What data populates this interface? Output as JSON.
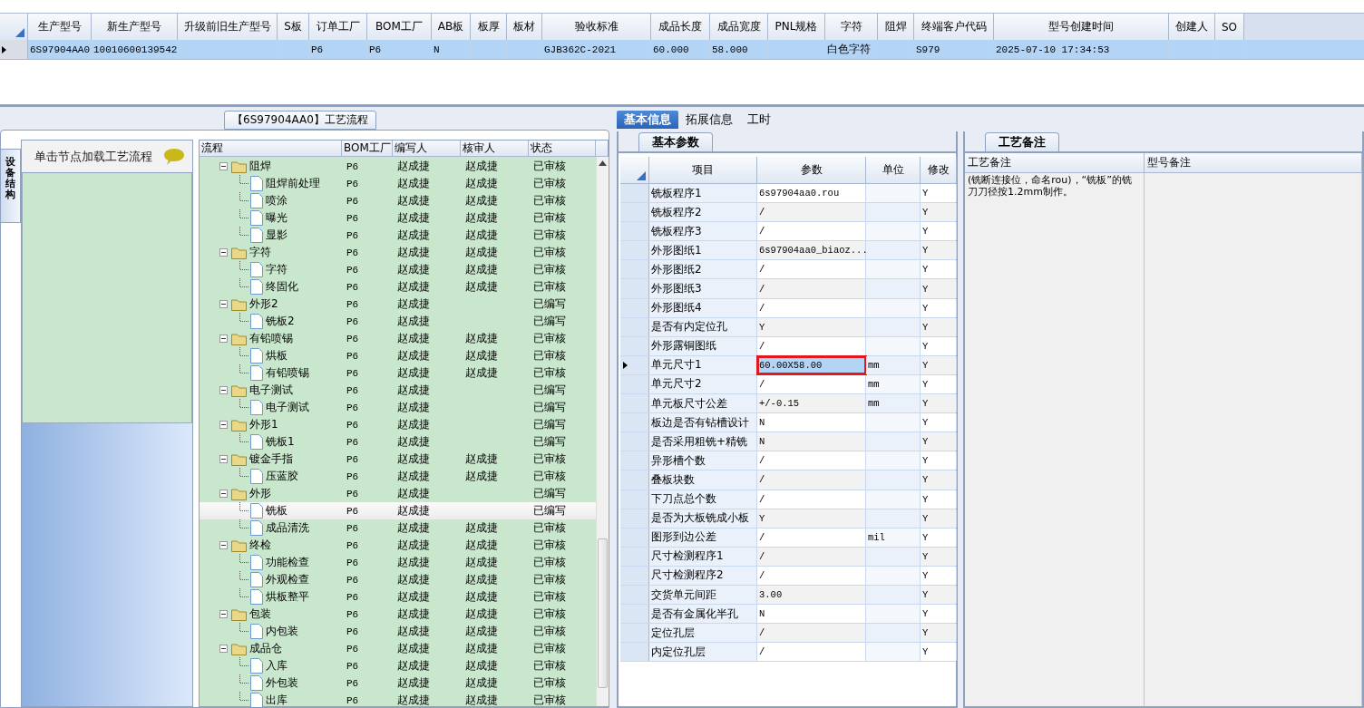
{
  "record_grid": {
    "columns": [
      "生产型号",
      "新生产型号",
      "升级前旧生产型号",
      "S板",
      "订单工厂",
      "BOM工厂",
      "AB板",
      "板厚",
      "板材",
      "验收标准",
      "成品长度",
      "成品宽度",
      "PNL规格",
      "字符",
      "阻焊",
      "终端客户代码",
      "型号创建时间",
      "创建人",
      "SO"
    ],
    "rows": [
      {
        "selected": true,
        "cells": [
          "6S97904AA0",
          "10010600139542",
          null,
          null,
          "P6",
          "P6",
          "N",
          null,
          null,
          "GJB362C-2021",
          "60.000",
          "58.000",
          null,
          "白色字符",
          null,
          "S979",
          "2025-07-10 17:34:53",
          null,
          null
        ]
      }
    ]
  },
  "process_panel": {
    "title": "【6S97904AA0】工艺流程",
    "side_tab": "设备结构",
    "hint": "单击节点加载工艺流程",
    "tree": {
      "columns": [
        "流程",
        "BOM工厂",
        "编写人",
        "核审人",
        "状态"
      ],
      "nodes": [
        {
          "name": "阻焊",
          "bom": "P6",
          "writer": "赵成捷",
          "reviewer": "赵成捷",
          "status": "已审核",
          "expanded": true,
          "selected": false,
          "children": [
            {
              "name": "阻焊前处理",
              "bom": "P6",
              "writer": "赵成捷",
              "reviewer": "赵成捷",
              "status": "已审核",
              "selected": false
            },
            {
              "name": "喷涂",
              "bom": "P6",
              "writer": "赵成捷",
              "reviewer": "赵成捷",
              "status": "已审核",
              "selected": false
            },
            {
              "name": "曝光",
              "bom": "P6",
              "writer": "赵成捷",
              "reviewer": "赵成捷",
              "status": "已审核",
              "selected": false
            },
            {
              "name": "显影",
              "bom": "P6",
              "writer": "赵成捷",
              "reviewer": "赵成捷",
              "status": "已审核",
              "selected": false
            }
          ]
        },
        {
          "name": "字符",
          "bom": "P6",
          "writer": "赵成捷",
          "reviewer": "赵成捷",
          "status": "已审核",
          "expanded": true,
          "selected": false,
          "children": [
            {
              "name": "字符",
              "bom": "P6",
              "writer": "赵成捷",
              "reviewer": "赵成捷",
              "status": "已审核",
              "selected": false
            },
            {
              "name": "终固化",
              "bom": "P6",
              "writer": "赵成捷",
              "reviewer": "赵成捷",
              "status": "已审核",
              "selected": false
            }
          ]
        },
        {
          "name": "外形2",
          "bom": "P6",
          "writer": "赵成捷",
          "status": "已编写",
          "expanded": true,
          "selected": false,
          "children": [
            {
              "name": "铣板2",
              "bom": "P6",
              "writer": "赵成捷",
              "status": "已编写",
              "selected": false
            }
          ]
        },
        {
          "name": "有铅喷锡",
          "bom": "P6",
          "writer": "赵成捷",
          "reviewer": "赵成捷",
          "status": "已审核",
          "expanded": true,
          "selected": false,
          "children": [
            {
              "name": "烘板",
              "bom": "P6",
              "writer": "赵成捷",
              "reviewer": "赵成捷",
              "status": "已审核",
              "selected": false
            },
            {
              "name": "有铅喷锡",
              "bom": "P6",
              "writer": "赵成捷",
              "reviewer": "赵成捷",
              "status": "已审核",
              "selected": false
            }
          ]
        },
        {
          "name": "电子测试",
          "bom": "P6",
          "writer": "赵成捷",
          "status": "已编写",
          "expanded": true,
          "selected": false,
          "children": [
            {
              "name": "电子测试",
              "bom": "P6",
              "writer": "赵成捷",
              "status": "已编写",
              "selected": false
            }
          ]
        },
        {
          "name": "外形1",
          "bom": "P6",
          "writer": "赵成捷",
          "status": "已编写",
          "expanded": true,
          "selected": false,
          "children": [
            {
              "name": "铣板1",
              "bom": "P6",
              "writer": "赵成捷",
              "status": "已编写",
              "selected": false
            }
          ]
        },
        {
          "name": "镀金手指",
          "bom": "P6",
          "writer": "赵成捷",
          "reviewer": "赵成捷",
          "status": "已审核",
          "expanded": true,
          "selected": false,
          "children": [
            {
              "name": "压蓝胶",
              "bom": "P6",
              "writer": "赵成捷",
              "reviewer": "赵成捷",
              "status": "已审核",
              "selected": false
            }
          ]
        },
        {
          "name": "外形",
          "bom": "P6",
          "writer": "赵成捷",
          "status": "已编写",
          "expanded": true,
          "selected": false,
          "children": [
            {
              "name": "铣板",
              "bom": "P6",
              "writer": "赵成捷",
              "status": "已编写",
              "selected": true
            },
            {
              "name": "成品清洗",
              "bom": "P6",
              "writer": "赵成捷",
              "reviewer": "赵成捷",
              "status": "已审核",
              "selected": false
            }
          ]
        },
        {
          "name": "终检",
          "bom": "P6",
          "writer": "赵成捷",
          "reviewer": "赵成捷",
          "status": "已审核",
          "expanded": true,
          "selected": false,
          "children": [
            {
              "name": "功能检查",
              "bom": "P6",
              "writer": "赵成捷",
              "reviewer": "赵成捷",
              "status": "已审核",
              "selected": false
            },
            {
              "name": "外观检查",
              "bom": "P6",
              "writer": "赵成捷",
              "reviewer": "赵成捷",
              "status": "已审核",
              "selected": false
            },
            {
              "name": "烘板整平",
              "bom": "P6",
              "writer": "赵成捷",
              "reviewer": "赵成捷",
              "status": "已审核",
              "selected": false
            }
          ]
        },
        {
          "name": "包装",
          "bom": "P6",
          "writer": "赵成捷",
          "reviewer": "赵成捷",
          "status": "已审核",
          "expanded": true,
          "selected": false,
          "children": [
            {
              "name": "内包装",
              "bom": "P6",
              "writer": "赵成捷",
              "reviewer": "赵成捷",
              "status": "已审核",
              "selected": false
            }
          ]
        },
        {
          "name": "成品仓",
          "bom": "P6",
          "writer": "赵成捷",
          "reviewer": "赵成捷",
          "status": "已审核",
          "expanded": true,
          "selected": false,
          "children": [
            {
              "name": "入库",
              "bom": "P6",
              "writer": "赵成捷",
              "reviewer": "赵成捷",
              "status": "已审核",
              "selected": false
            },
            {
              "name": "外包装",
              "bom": "P6",
              "writer": "赵成捷",
              "reviewer": "赵成捷",
              "status": "已审核",
              "selected": false
            },
            {
              "name": "出库",
              "bom": "P6",
              "writer": "赵成捷",
              "reviewer": "赵成捷",
              "status": "已审核",
              "selected": false
            }
          ]
        }
      ]
    }
  },
  "detail_tabs": [
    {
      "label": "基本信息",
      "selected": true
    },
    {
      "label": "拓展信息",
      "selected": false
    },
    {
      "label": "工时",
      "selected": false
    }
  ],
  "params": {
    "tab": "基本参数",
    "columns": [
      "项目",
      "参数",
      "单位",
      "修改"
    ],
    "rows": [
      {
        "item": "铣板程序1",
        "value": "6s97904aa0.rou",
        "modify": "Y",
        "current": false
      },
      {
        "item": "铣板程序2",
        "value": "/",
        "modify": "Y",
        "current": false
      },
      {
        "item": "铣板程序3",
        "value": "/",
        "modify": "Y",
        "current": false
      },
      {
        "item": "外形图纸1",
        "value": "6s97904aa0_biaoz...",
        "modify": "Y",
        "current": false
      },
      {
        "item": "外形图纸2",
        "value": "/",
        "modify": "Y",
        "current": false
      },
      {
        "item": "外形图纸3",
        "value": "/",
        "modify": "Y",
        "current": false
      },
      {
        "item": "外形图纸4",
        "value": "/",
        "modify": "Y",
        "current": false
      },
      {
        "item": "是否有内定位孔",
        "value": "Y",
        "modify": "Y",
        "current": false
      },
      {
        "item": "外形露铜图纸",
        "value": "/",
        "modify": "Y",
        "current": false
      },
      {
        "item": "单元尺寸1",
        "value": "60.00X58.00",
        "unit": "mm",
        "modify": "Y",
        "current": true
      },
      {
        "item": "单元尺寸2",
        "value": "/",
        "unit": "mm",
        "modify": "Y",
        "current": false
      },
      {
        "item": "单元板尺寸公差",
        "value": "+/-0.15",
        "unit": "mm",
        "modify": "Y",
        "current": false
      },
      {
        "item": "板边是否有钻槽设计",
        "value": "N",
        "modify": "Y",
        "current": false
      },
      {
        "item": "是否采用粗铣+精铣",
        "value": "N",
        "modify": "Y",
        "current": false
      },
      {
        "item": "异形槽个数",
        "value": "/",
        "modify": "Y",
        "current": false
      },
      {
        "item": "叠板块数",
        "value": "/",
        "modify": "Y",
        "current": false
      },
      {
        "item": "下刀点总个数",
        "value": "/",
        "modify": "Y",
        "current": false
      },
      {
        "item": "是否为大板铣成小板",
        "value": "Y",
        "modify": "Y",
        "current": false
      },
      {
        "item": "图形到边公差",
        "value": "/",
        "unit": "mil",
        "modify": "Y",
        "current": false
      },
      {
        "item": "尺寸检测程序1",
        "value": "/",
        "modify": "Y",
        "current": false
      },
      {
        "item": "尺寸检测程序2",
        "value": "/",
        "modify": "Y",
        "current": false
      },
      {
        "item": "交货单元间距",
        "value": "3.00",
        "modify": "Y",
        "current": false
      },
      {
        "item": "是否有金属化半孔",
        "value": "N",
        "modify": "Y",
        "current": false
      },
      {
        "item": "定位孔层",
        "value": "/",
        "modify": "Y",
        "current": false
      },
      {
        "item": "内定位孔层",
        "value": "/",
        "modify": "Y",
        "current": false
      }
    ]
  },
  "notes": {
    "tab": "工艺备注",
    "columns": [
      "工艺备注",
      "型号备注"
    ],
    "cells": [
      "(铣断连接位，命名rou)，“铣板”的铣刀刀径按1.2mm制作。"
    ]
  }
}
